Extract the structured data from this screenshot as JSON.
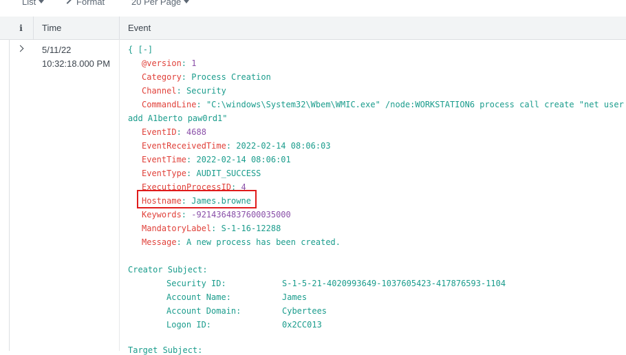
{
  "toolbar": {
    "list_label": "List",
    "format_label": "Format",
    "per_page_label": "20 Per Page"
  },
  "header": {
    "info_label": "i",
    "time_label": "Time",
    "event_label": "Event"
  },
  "row": {
    "date": "5/11/22",
    "time": "10:32:18.000 PM",
    "open_brace": "{",
    "collapse": "[-]",
    "fields": [
      {
        "key": "@version",
        "value": "1"
      },
      {
        "key": "Category",
        "value": "Process Creation"
      },
      {
        "key": "Channel",
        "value": "Security"
      },
      {
        "key": "CommandLine",
        "value": "\"C:\\windows\\System32\\Wbem\\WMIC.exe\" /node:WORKSTATION6 process call create \"net user /",
        "value_cont": "add A1berto paw0rd1\""
      },
      {
        "key": "EventID",
        "value": "4688"
      },
      {
        "key": "EventReceivedTime",
        "value": "2022-02-14 08:06:03"
      },
      {
        "key": "EventTime",
        "value": "2022-02-14 08:06:01"
      },
      {
        "key": "EventType",
        "value": "AUDIT_SUCCESS"
      },
      {
        "key": "ExecutionProcessID",
        "value": "4"
      },
      {
        "key": "Hostname",
        "value": "James.browne"
      },
      {
        "key": "Keywords",
        "value": "-9214364837600035000"
      },
      {
        "key": "MandatoryLabel",
        "value": "S-1-16-12288"
      },
      {
        "key": "Message",
        "value": "A new process has been created."
      }
    ],
    "creator_subject": "Creator Subject:",
    "creator_fields": [
      {
        "label": "Security ID:",
        "value": "S-1-5-21-4020993649-1037605423-417876593-1104"
      },
      {
        "label": "Account Name:",
        "value": "James"
      },
      {
        "label": "Account Domain:",
        "value": "Cybertees"
      },
      {
        "label": "Logon ID:",
        "value": "0x2CC013"
      }
    ],
    "target_subject": "Target Subject:"
  },
  "colors": {
    "key": "#e0413a",
    "value": "#1a9c8c",
    "number": "#8a4fa8",
    "highlight": "#e01b1b"
  }
}
